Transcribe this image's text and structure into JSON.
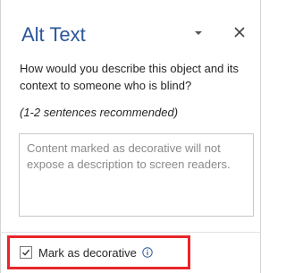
{
  "pane": {
    "title": "Alt Text",
    "prompt": "How would you describe this object and its context to someone who is blind?",
    "hint": "(1-2 sentences recommended)",
    "description_placeholder": "Content marked as decorative will not expose a description to screen readers.",
    "decorative_label": "Mark as decorative",
    "decorative_checked": true
  },
  "icons": {
    "dropdown": "chevron-down-icon",
    "close": "close-icon",
    "checkmark": "checkmark-icon",
    "info": "info-icon"
  },
  "colors": {
    "title": "#2b579a",
    "info": "#2b579a",
    "highlight": "#e8262a"
  }
}
